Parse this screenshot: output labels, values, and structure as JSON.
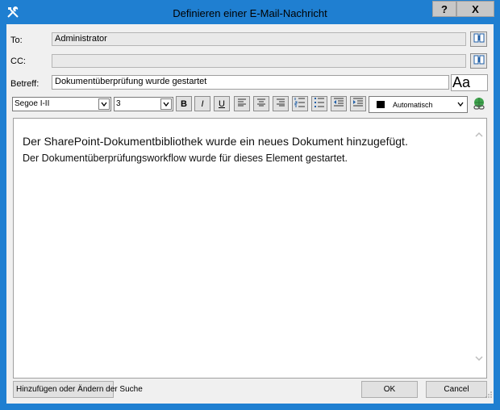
{
  "window": {
    "title": "Definieren einer E-Mail-Nachricht",
    "help_label": "?",
    "close_label": "X",
    "app_icon": "tools-icon"
  },
  "form": {
    "to_label": "To:",
    "to_value": "Administrator",
    "cc_label": "CC:",
    "cc_value": "",
    "subject_label": "Betreff:",
    "subject_value": "Dokumentüberprüfung wurde gestartet",
    "address_book_icon": "address-book-icon",
    "aa_label": "Aa"
  },
  "toolbar": {
    "font_name": "Segoe I-II",
    "font_size": "3",
    "bold": "B",
    "italic": "I",
    "underline": "U",
    "color_name": "Automatisch",
    "color_value": "#000000"
  },
  "body": {
    "line1": "Der SharePoint-Dokumentbibliothek wurde ein neues Dokument hinzugefügt.",
    "line2": "Der Dokumentüberprüfungsworkflow wurde für dieses Element gestartet."
  },
  "buttons": {
    "lookup": "Hinzufügen oder Ändern der Suche",
    "ok": "OK",
    "cancel": "Cancel"
  }
}
